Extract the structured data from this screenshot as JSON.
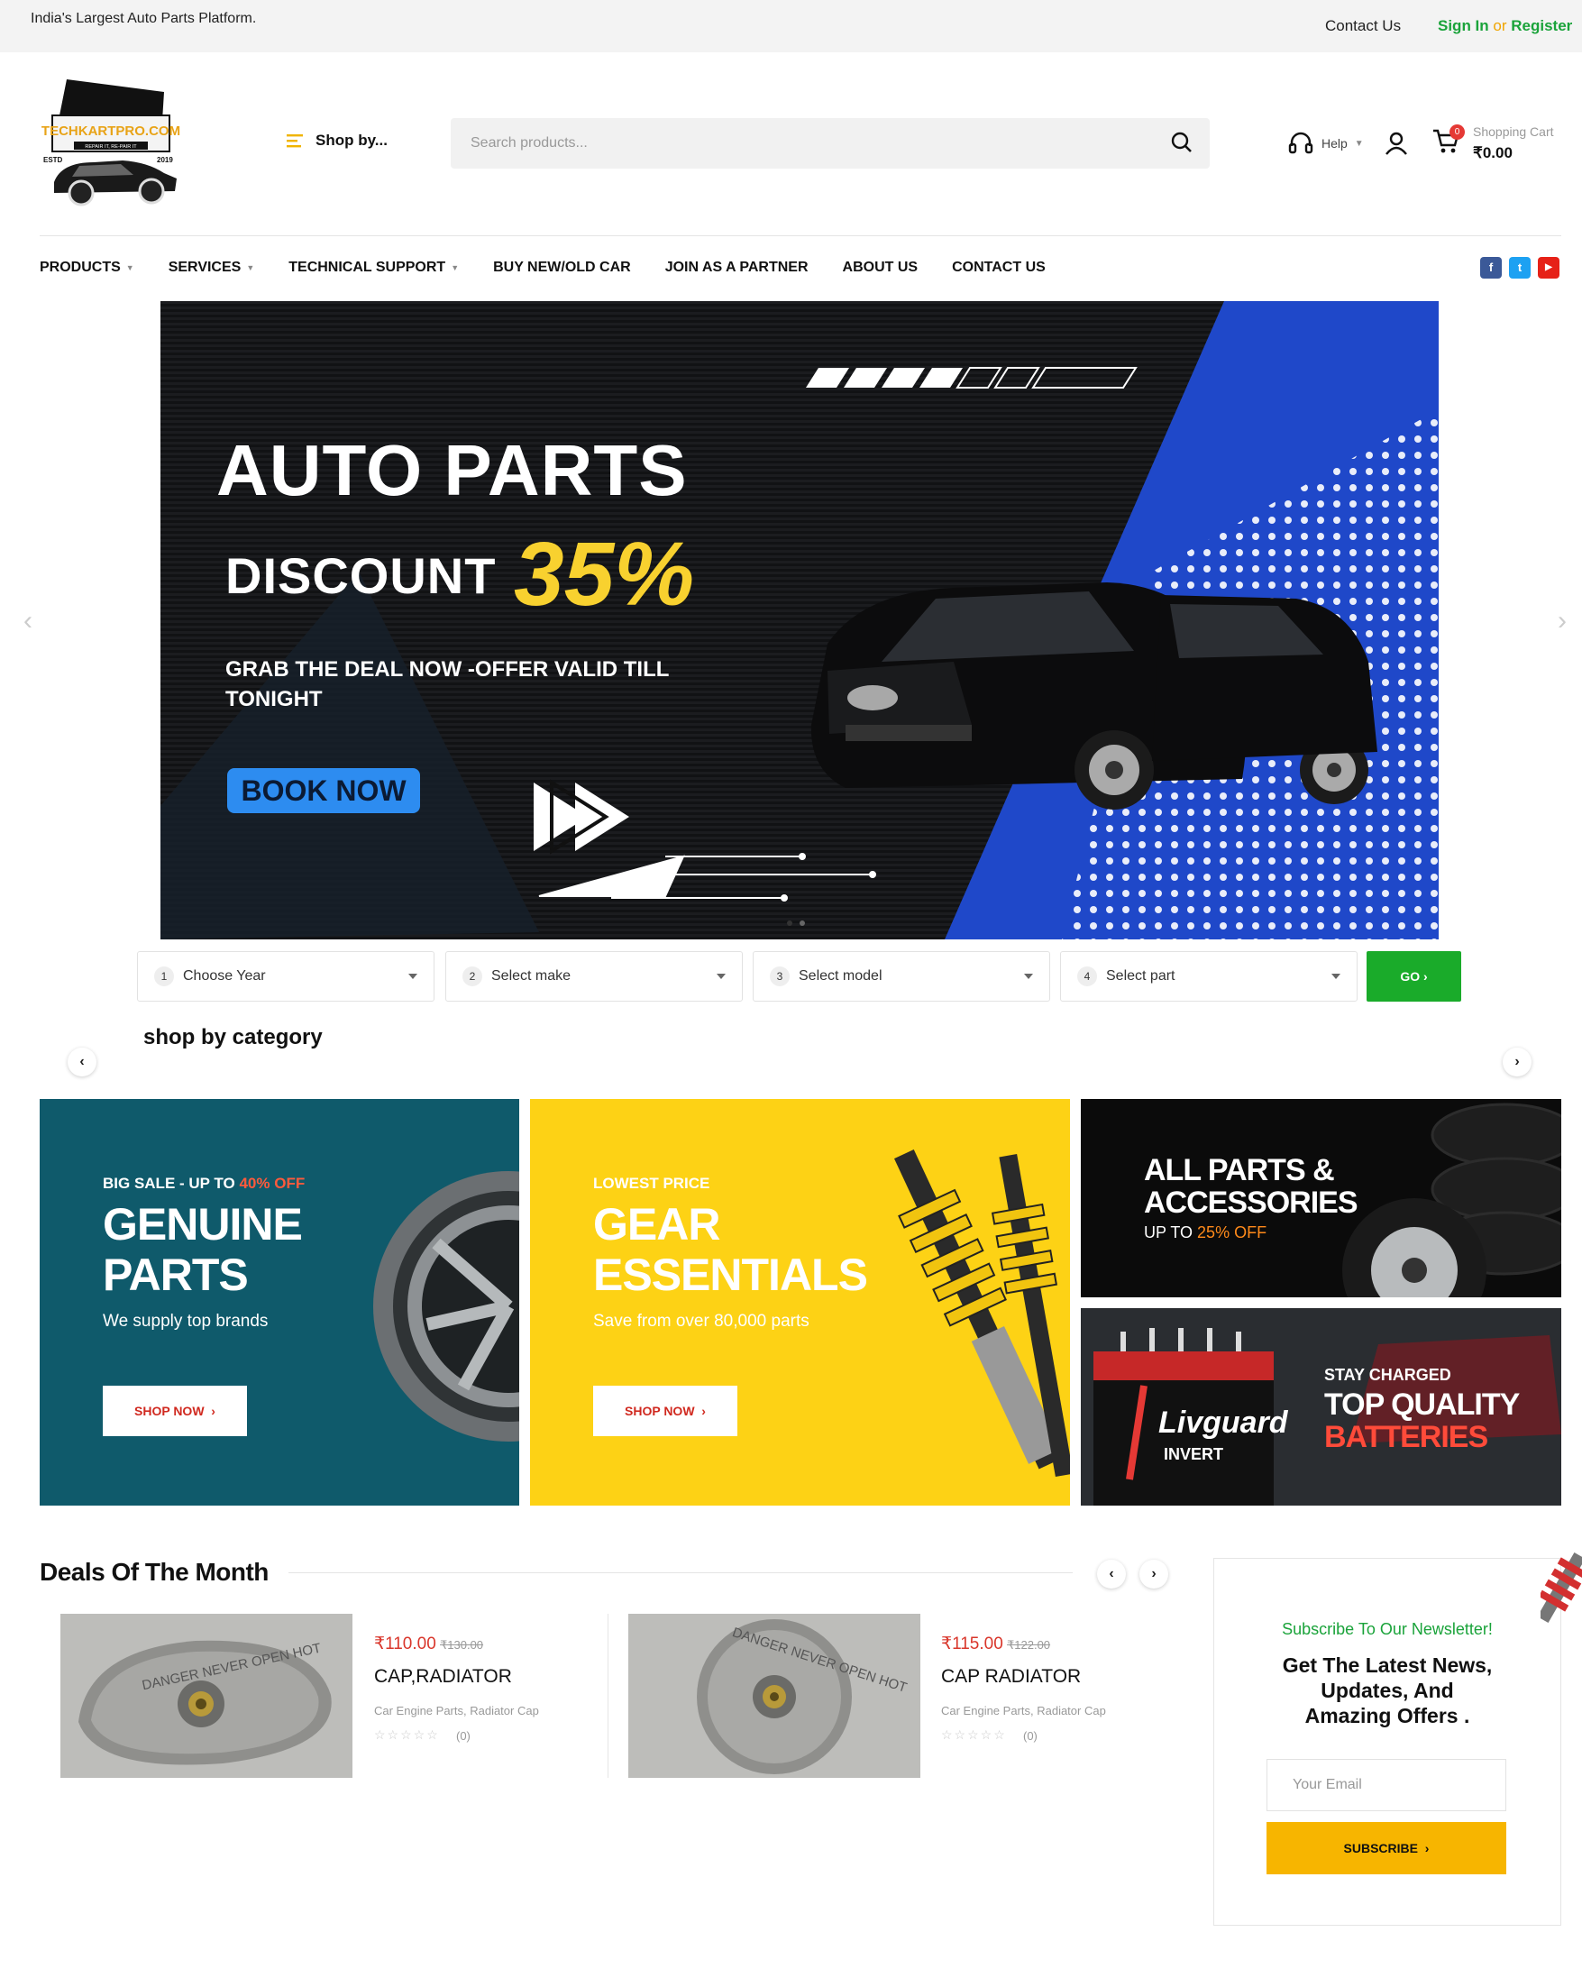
{
  "topbar": {
    "tagline": "India's Largest Auto Parts Platform.",
    "contact": "Contact Us",
    "sign_in": "Sign In",
    "or": "or",
    "register": "Register"
  },
  "logo": {
    "brand": "TECHKARTPRO.COM",
    "motto": "REPAIR IT, RE-PAIR IT",
    "estd": "ESTD",
    "year": "2019"
  },
  "header": {
    "shop_by": "Shop by...",
    "search_placeholder": "Search products...",
    "help": "Help",
    "cart_label": "Shopping Cart",
    "cart_total": "₹0.00",
    "cart_count": "0"
  },
  "nav": {
    "items": [
      {
        "label": "PRODUCTS",
        "dropdown": true
      },
      {
        "label": "SERVICES",
        "dropdown": true
      },
      {
        "label": "TECHNICAL SUPPORT",
        "dropdown": true
      },
      {
        "label": "BUY NEW/OLD CAR",
        "dropdown": false
      },
      {
        "label": "JOIN AS A PARTNER",
        "dropdown": false
      },
      {
        "label": "ABOUT US",
        "dropdown": false
      },
      {
        "label": "CONTACT US",
        "dropdown": false
      }
    ],
    "social": [
      {
        "icon": "facebook-icon",
        "glyph": "f",
        "color": "#3b5998"
      },
      {
        "icon": "twitter-icon",
        "glyph": "t",
        "color": "#1da1f2"
      },
      {
        "icon": "youtube-icon",
        "glyph": "▶",
        "color": "#e62117"
      }
    ]
  },
  "hero": {
    "title": "AUTO PARTS",
    "discount": "DISCOUNT",
    "percent": "35%",
    "subtitle": "GRAB THE DEAL NOW -OFFER VALID TILL TONIGHT",
    "button": "BOOK NOW",
    "slide_index": 2,
    "slide_count": 2
  },
  "selectors": {
    "items": [
      {
        "num": "1",
        "label": "Choose Year"
      },
      {
        "num": "2",
        "label": "Select make"
      },
      {
        "num": "3",
        "label": "Select model"
      },
      {
        "num": "4",
        "label": "Select part"
      }
    ],
    "go": "GO"
  },
  "categories": {
    "title": "shop by category",
    "genuine": {
      "kicker": "BIG SALE - UP TO",
      "kicker_accent": "40% OFF",
      "line1": "GENUINE",
      "line2": "PARTS",
      "sub": "We supply top brands",
      "button": "SHOP NOW"
    },
    "gear": {
      "kicker": "LOWEST PRICE",
      "line1": "GEAR",
      "line2": "ESSENTIALS",
      "sub": "Save from over 80,000 parts",
      "button": "SHOP NOW"
    },
    "accessories": {
      "line1": "ALL PARTS &",
      "line2": "ACCESSORIES",
      "sub": "UP TO",
      "sub_accent": "25% OFF"
    },
    "batteries": {
      "kicker": "STAY CHARGED",
      "line1": "TOP QUALITY",
      "line2": "BATTERIES",
      "brand": "Livguard",
      "brand2": "INVERT"
    }
  },
  "deals": {
    "title": "Deals Of The Month",
    "products": [
      {
        "price": "₹110.00",
        "old_price": "₹130.00",
        "name": "CAP,RADIATOR",
        "category": "Car Engine Parts, Radiator Cap",
        "stars": "☆☆☆☆☆",
        "reviews": "(0)",
        "cap_text": "DANGER NEVER OPEN HOT"
      },
      {
        "price": "₹115.00",
        "old_price": "₹122.00",
        "name": "CAP RADIATOR",
        "category": "Car Engine Parts, Radiator Cap",
        "stars": "☆☆☆☆☆",
        "reviews": "(0)",
        "cap_text": "DANGER NEVER OPEN HOT"
      }
    ]
  },
  "newsletter": {
    "kicker": "Subscribe To Our Newsletter!",
    "heading": "Get The Latest News, Updates, And Amazing Offers .",
    "placeholder": "Your Email",
    "button": "SUBSCRIBE"
  },
  "colors": {
    "accent_green": "#1aa33a",
    "accent_yellow": "#f8d12f",
    "hero_blue": "#1f48c9",
    "sale_red": "#d9362b"
  }
}
